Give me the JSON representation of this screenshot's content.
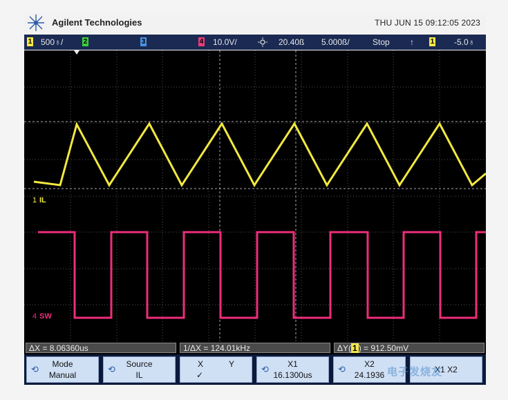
{
  "header": {
    "brand": "Agilent Technologies",
    "datetime": "THU JUN 15 09:12:05 2023"
  },
  "status_bar": {
    "ch1_number": "1",
    "ch1_scale": "500♁/",
    "ch2_number": "2",
    "ch3_number": "3",
    "ch4_number": "4",
    "ch4_scale": "10.0V/",
    "time_position": "20.40ß",
    "time_scale": "5.000ß/",
    "run_state": "Stop",
    "trigger_symbol": "↑",
    "trigger_channel": "1",
    "trigger_level": "-5.0♁",
    "colors": {
      "ch1": "#f4e84a",
      "ch2": "#3ad03a",
      "ch3": "#4a90e0",
      "ch4": "#e83c7a"
    }
  },
  "screen": {
    "ch1_label": "IL",
    "ch4_label": "SW",
    "trace_colors": {
      "ch1": "#f2e840",
      "ch4": "#ee2d7a"
    }
  },
  "measurements": {
    "dx": "ΔX = 8.06360us",
    "inv_dx": "1/ΔX = 124.01kHz",
    "dy_prefix": "ΔY(",
    "dy_channel": "1",
    "dy_suffix": ") = 912.50mV"
  },
  "softkeys": [
    {
      "line1": "Mode",
      "line2": "Manual"
    },
    {
      "line1": "Source",
      "line2": "IL"
    },
    {
      "line1": "X",
      "line1b": "Y",
      "line2": "✓"
    },
    {
      "line1": "X1",
      "line2": "16.1300us"
    },
    {
      "line1": "X2",
      "line2": "24.1936"
    },
    {
      "line1": "X1 X2",
      "line2": ""
    }
  ],
  "watermark": "电子发烧友"
}
